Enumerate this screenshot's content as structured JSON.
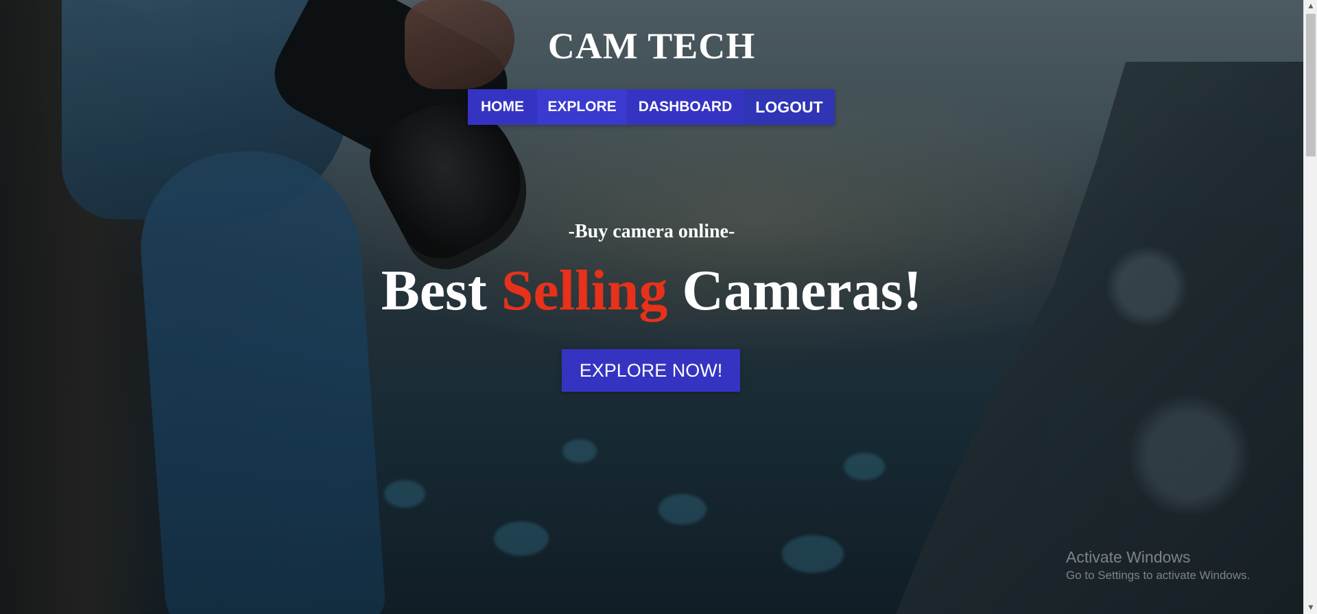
{
  "header": {
    "brand": "CAM TECH"
  },
  "nav": {
    "items": [
      {
        "label": "HOME"
      },
      {
        "label": "EXPLORE"
      },
      {
        "label": "DASHBOARD"
      },
      {
        "label": "LOGOUT"
      }
    ]
  },
  "hero": {
    "tagline": "-Buy camera online-",
    "headline": {
      "part1": "Best ",
      "accent": "Selling",
      "part2": " Cameras!"
    },
    "cta_label": "EXPLORE NOW!"
  },
  "watermark": {
    "title": "Activate Windows",
    "subtitle": "Go to Settings to activate Windows."
  },
  "scrollbar": {
    "up_icon": "▲",
    "down_icon": "▼"
  },
  "colors": {
    "nav_blue": "#3534c2",
    "accent_red": "#e8311a",
    "text_white": "#ffffff"
  }
}
